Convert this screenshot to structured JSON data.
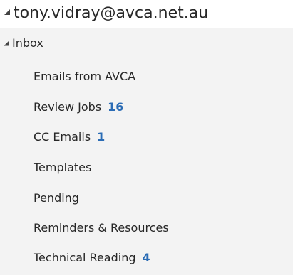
{
  "account": {
    "name": "tony.vidray@avca.net.au",
    "toggle_icon": "expanded-triangle-icon"
  },
  "inbox": {
    "label": "Inbox",
    "toggle_icon": "expanded-triangle-icon"
  },
  "folders": [
    {
      "label": "Emails from AVCA",
      "count": ""
    },
    {
      "label": "Review Jobs",
      "count": "16"
    },
    {
      "label": "CC Emails",
      "count": "1"
    },
    {
      "label": "Templates",
      "count": ""
    },
    {
      "label": "Pending",
      "count": ""
    },
    {
      "label": "Reminders & Resources",
      "count": ""
    },
    {
      "label": "Technical Reading",
      "count": "4"
    }
  ],
  "colors": {
    "unread_count": "#2b6cb5",
    "pane_background": "#f3f3f3",
    "text": "#262626"
  }
}
